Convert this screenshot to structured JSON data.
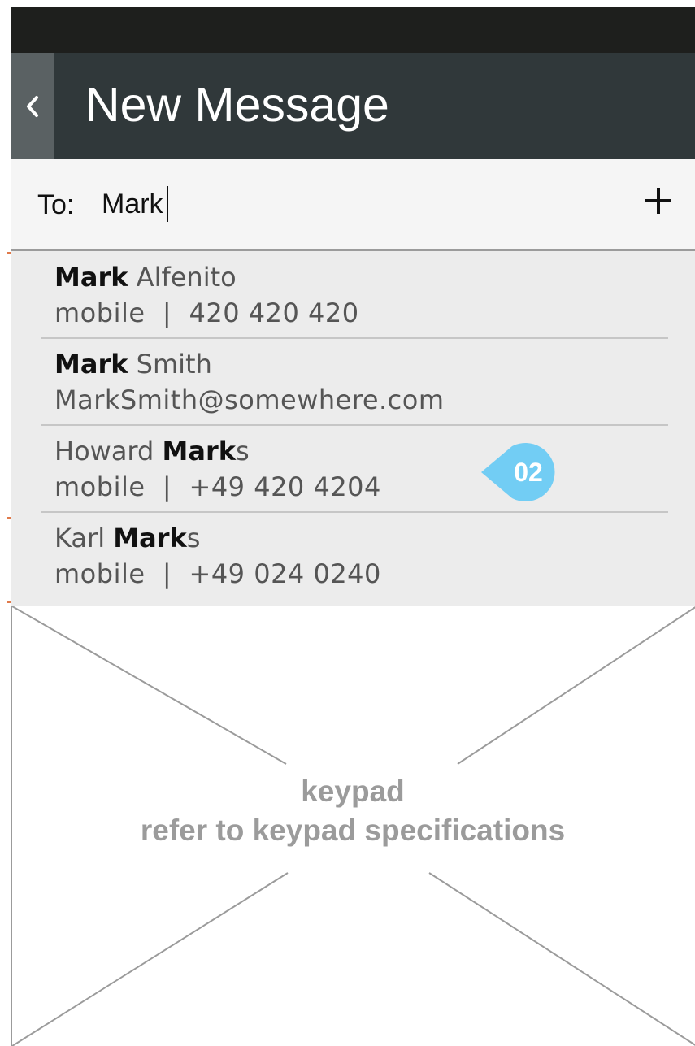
{
  "header": {
    "title": "New Message",
    "back_icon": "chevron-left-icon"
  },
  "compose": {
    "to_label": "To:",
    "to_value": "Mark",
    "add_icon": "plus-icon"
  },
  "suggestions": [
    {
      "name_parts": [
        {
          "text": "Mark",
          "bold": true
        },
        {
          "text": " Alfenito",
          "bold": false
        }
      ],
      "detail": "mobile  |  420 420 420"
    },
    {
      "name_parts": [
        {
          "text": "Mark",
          "bold": true
        },
        {
          "text": " Smith",
          "bold": false
        }
      ],
      "detail": "MarkSmith@somewhere.com"
    },
    {
      "name_parts": [
        {
          "text": "Howard ",
          "bold": false
        },
        {
          "text": "Mark",
          "bold": true
        },
        {
          "text": "s",
          "bold": false
        }
      ],
      "detail": "mobile  |  +49 420 4204"
    },
    {
      "name_parts": [
        {
          "text": "Karl ",
          "bold": false
        },
        {
          "text": "Mark",
          "bold": true
        },
        {
          "text": "s",
          "bold": false
        }
      ],
      "detail": "mobile  |  +49 024 0240"
    }
  ],
  "annotation": {
    "label": "02",
    "color": "#72cdf4"
  },
  "keypad": {
    "line1": "keypad",
    "line2": "refer to keypad specifications"
  },
  "colors": {
    "status_bar": "#1e1f1d",
    "header": "#30383a",
    "back_button": "#5a6163",
    "suggestions_bg": "#ececec"
  }
}
